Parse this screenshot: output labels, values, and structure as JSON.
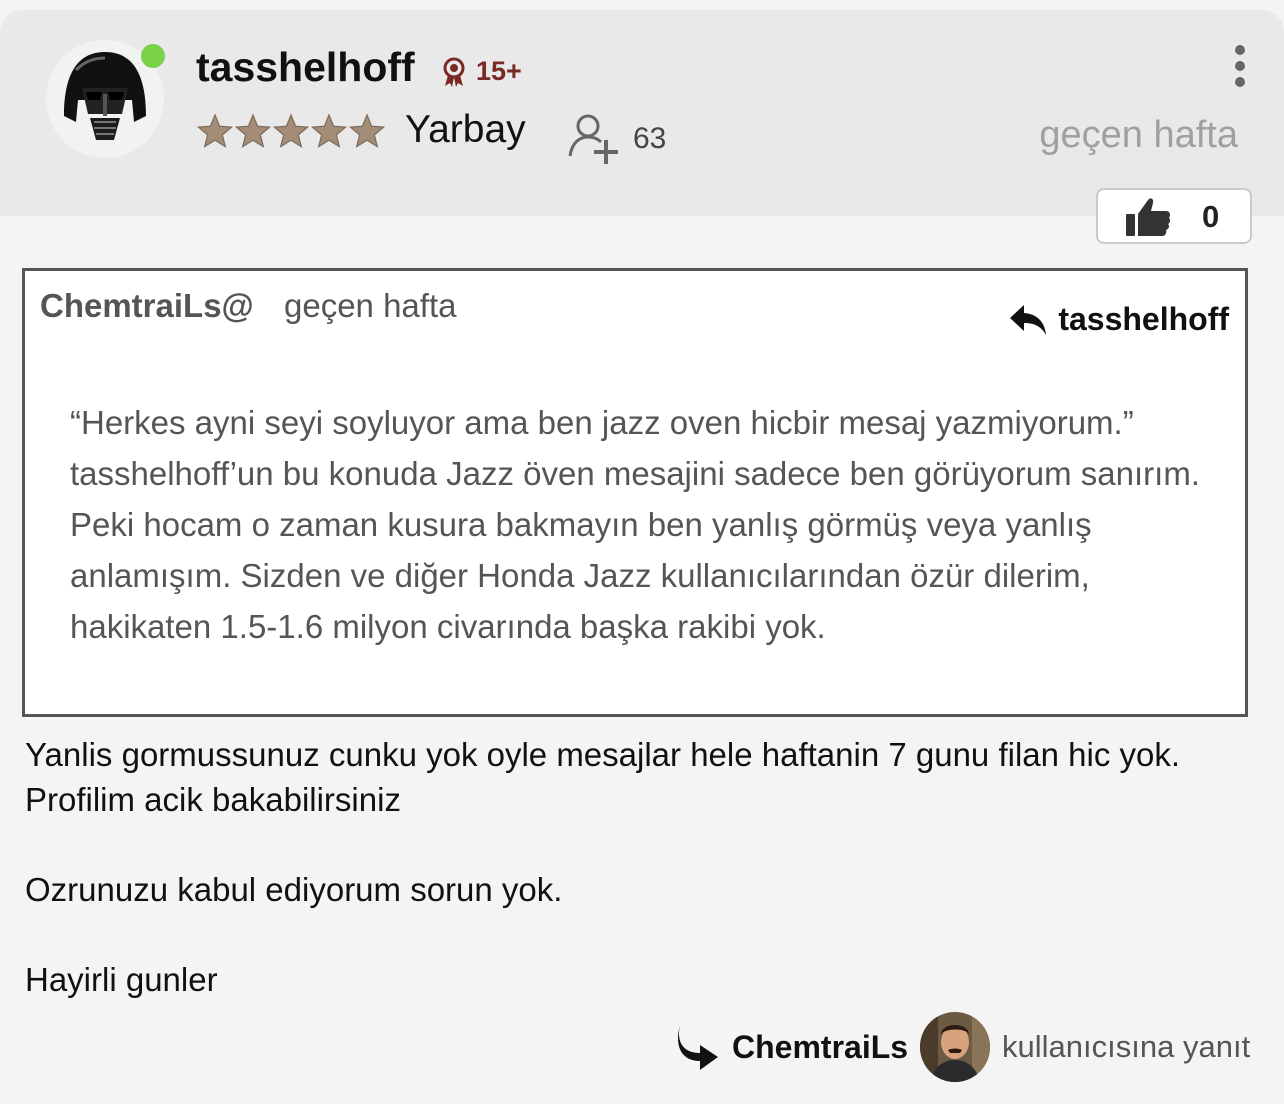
{
  "post": {
    "author": "tasshelhoff",
    "badge_count": "15+",
    "rank_title": "Yarbay",
    "star_count": 5,
    "follower_count": "63",
    "timestamp": "geçen hafta",
    "likes": "0"
  },
  "quote": {
    "author": "ChemtraiLs@",
    "time": "geçen hafta",
    "reply_back_name": "tasshelhoff",
    "lines": [
      "“Herkes ayni seyi soyluyor ama ben jazz oven hicbir mesaj yazmiyorum.”",
      "tasshelhoff’un bu konuda Jazz öven mesajini sadece ben görüyorum sanırım. Peki hocam o zaman kusura bakmayın ben yanlış görmüş veya yanlış anlamışım. Sizden ve diğer Honda Jazz kullanıcılarından özür dilerim, hakikaten 1.5-1.6 milyon civarında başka rakibi yok."
    ]
  },
  "body": {
    "paragraph_1": "Yanlis gormussunuz cunku yok oyle mesajlar hele haftanin 7 gunu filan hic yok. Profilim acik bakabilirsiniz",
    "paragraph_2": "Ozrunuzu kabul ediyorum sorun yok.",
    "paragraph_3": "Hayirli gunler"
  },
  "reply_to": {
    "name": "ChemtraiLs",
    "label": "kullanıcısına yanıt"
  },
  "colors": {
    "online": "#7bd148",
    "badge": "#7a2a24",
    "muted": "#a0a0a0",
    "header_bg": "#e9e9e9"
  },
  "icons": [
    "avatar-darth-vader",
    "rank-medal-icon",
    "star-icon",
    "add-user-icon",
    "more-vertical-icon",
    "thumbs-up-icon",
    "reply-back-arrow-icon",
    "reply-arrow-icon"
  ]
}
